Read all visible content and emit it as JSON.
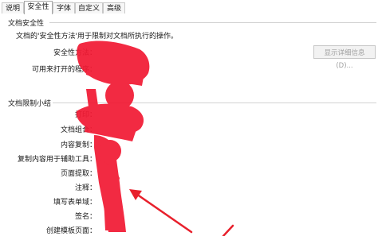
{
  "tabs": [
    {
      "label": "说明",
      "active": false
    },
    {
      "label": "安全性",
      "active": true
    },
    {
      "label": "字体",
      "active": false
    },
    {
      "label": "自定义",
      "active": false
    },
    {
      "label": "高级",
      "active": false
    }
  ],
  "security": {
    "title": "文档安全性",
    "description": "文档的'安全性方法'用于限制对文档所执行的操作。",
    "method_label": "安全性方法：",
    "open_program_label": "可用来打开的程序：",
    "details_button": "显示详细信息(D)..."
  },
  "restrictions": {
    "title": "文档限制小结",
    "items": [
      {
        "label": "打印："
      },
      {
        "label": "文档组合："
      },
      {
        "label": "内容复制："
      },
      {
        "label": "复制内容用于辅助工具："
      },
      {
        "label": "页面提取："
      },
      {
        "label": "注释："
      },
      {
        "label": "填写表单域："
      },
      {
        "label": "签名："
      },
      {
        "label": "创建模板页面："
      }
    ]
  },
  "colors": {
    "redaction": "#f21a34",
    "arrow": "#e8202c"
  }
}
